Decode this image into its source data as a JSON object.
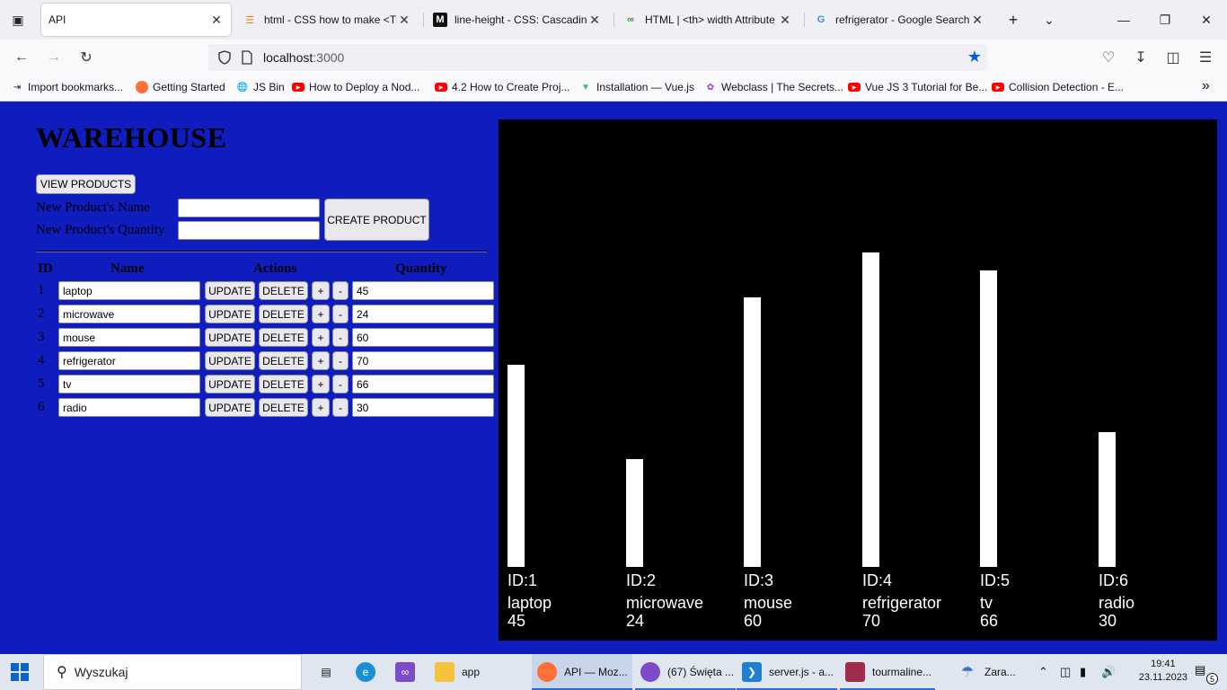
{
  "browser": {
    "tabs": [
      {
        "title": "API",
        "icon": "blank-page-icon"
      },
      {
        "title": "html - CSS how to make <TD",
        "icon": "stackoverflow-icon"
      },
      {
        "title": "line-height - CSS: Cascading",
        "icon": "mdn-icon"
      },
      {
        "title": "HTML | <th> width Attribute",
        "icon": "geeksforgeeks-icon"
      },
      {
        "title": "refrigerator - Google Search",
        "icon": "google-icon"
      }
    ],
    "url_host": "localhost",
    "url_port": ":3000",
    "bookmarks": [
      "Import bookmarks...",
      "Getting Started",
      "JS Bin",
      "How to Deploy a Nod...",
      "4.2 How to Create Proj...",
      "Installation — Vue.js",
      "Webclass | The Secrets...",
      "Vue JS 3 Tutorial for Be...",
      "Collision Detection - E..."
    ]
  },
  "app": {
    "title": "WAREHOUSE",
    "view_products_label": "VIEW PRODUCTS",
    "new_name_label": "New Product's Name",
    "new_quantity_label": "New Product's Quantity",
    "new_name_value": "",
    "new_quantity_value": "",
    "create_label": "CREATE PRODUCT",
    "headers": {
      "id": "ID",
      "name": "Name",
      "actions": "Actions",
      "quantity": "Quantity"
    },
    "update_label": "UPDATE",
    "delete_label": "DELETE",
    "plus_label": "+",
    "minus_label": "-",
    "products": [
      {
        "id": "1",
        "name": "laptop",
        "quantity": "45"
      },
      {
        "id": "2",
        "name": "microwave",
        "quantity": "24"
      },
      {
        "id": "3",
        "name": "mouse",
        "quantity": "60"
      },
      {
        "id": "4",
        "name": "refrigerator",
        "quantity": "70"
      },
      {
        "id": "5",
        "name": "tv",
        "quantity": "66"
      },
      {
        "id": "6",
        "name": "radio",
        "quantity": "30"
      }
    ]
  },
  "chart_data": {
    "type": "bar",
    "categories": [
      "laptop",
      "microwave",
      "mouse",
      "refrigerator",
      "tv",
      "radio"
    ],
    "id_labels": [
      "ID:1",
      "ID:2",
      "ID:3",
      "ID:4",
      "ID:5",
      "ID:6"
    ],
    "values": [
      45,
      24,
      60,
      70,
      66,
      30
    ],
    "value_labels": [
      "45",
      "24",
      "60",
      "70",
      "66",
      "30"
    ],
    "background": "#000000",
    "bar_color": "#ffffff"
  },
  "taskbar": {
    "search_placeholder": "Wyszukaj",
    "items": [
      "app",
      "API — Moz...",
      "(67) Święta ...",
      "server.js - a...",
      "tourmaline...",
      "Zara..."
    ],
    "time": "19:41",
    "date": "23.11.2023",
    "notification_count": "5"
  },
  "colors": {
    "page_bg": "#0f1cbe",
    "accent": "#0061e0"
  }
}
